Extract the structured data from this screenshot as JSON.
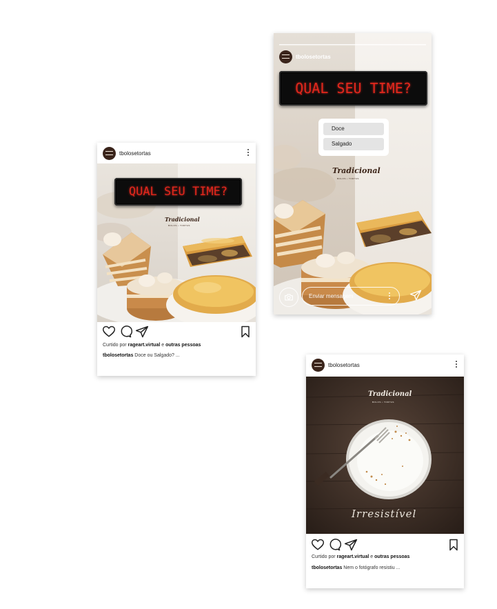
{
  "post1": {
    "username": "tbolosetortas",
    "led_text": "QUAL SEU TIME?",
    "brand": "Tradicional",
    "brand_sub": "BOLOS • TORTAS",
    "liked_prefix": "Curtido por",
    "liked_user": "rageart.virtual",
    "liked_and": "e",
    "liked_others": "outras pessoas",
    "caption_user": "tbolosetortas",
    "caption_text": "Doce ou Salgado? ..."
  },
  "story": {
    "username": "tbolosetortas",
    "led_text": "QUAL SEU TIME?",
    "poll_options": [
      "Doce",
      "Salgado"
    ],
    "brand": "Tradicional",
    "brand_sub": "BOLOS • TORTAS",
    "message_placeholder": "Enviar mensagem"
  },
  "post2": {
    "username": "tbolosetortas",
    "brand": "Tradicional",
    "brand_sub": "BOLOS • TORTAS",
    "tagline": "Irresistível",
    "liked_prefix": "Curtido por",
    "liked_user": "rageart.virtual",
    "liked_and": "e",
    "liked_others": "outras pessoas",
    "caption_user": "tbolosetortas",
    "caption_text": "Nem o fotógrafo resistiu ..."
  },
  "icons": {
    "like": "heart-icon",
    "comment": "comment-icon",
    "share": "send-icon",
    "save": "bookmark-icon",
    "more": "more-icon",
    "camera": "camera-icon"
  },
  "colors": {
    "led_text": "#e2271c",
    "brand": "#3b2418",
    "avatar": "#3a241b",
    "wood": "#3e2e25"
  }
}
